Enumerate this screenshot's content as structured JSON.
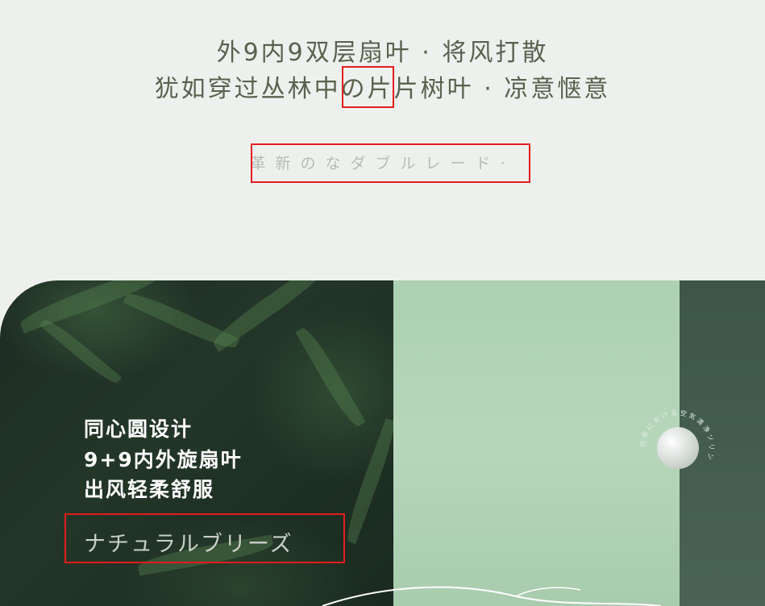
{
  "top": {
    "line1": "外9内9双层扇叶 · 将风打散",
    "line2": "犹如穿过丛林中の片片树叶 · 凉意惬意",
    "jp_subtitle": "革新のなダブルレード·"
  },
  "feature": {
    "headline1": "同心圆设计",
    "headline2": "9+9内外旋扇叶",
    "headline3": "出风轻柔舒服",
    "jp_tagline": "ナチュラルブリーズ",
    "orb_ring_text": "日本における空気清浄ソリン"
  },
  "colors": {
    "highlight": "#e41c1c",
    "mint": "#b0d2b4",
    "forest": "#1f3025"
  }
}
